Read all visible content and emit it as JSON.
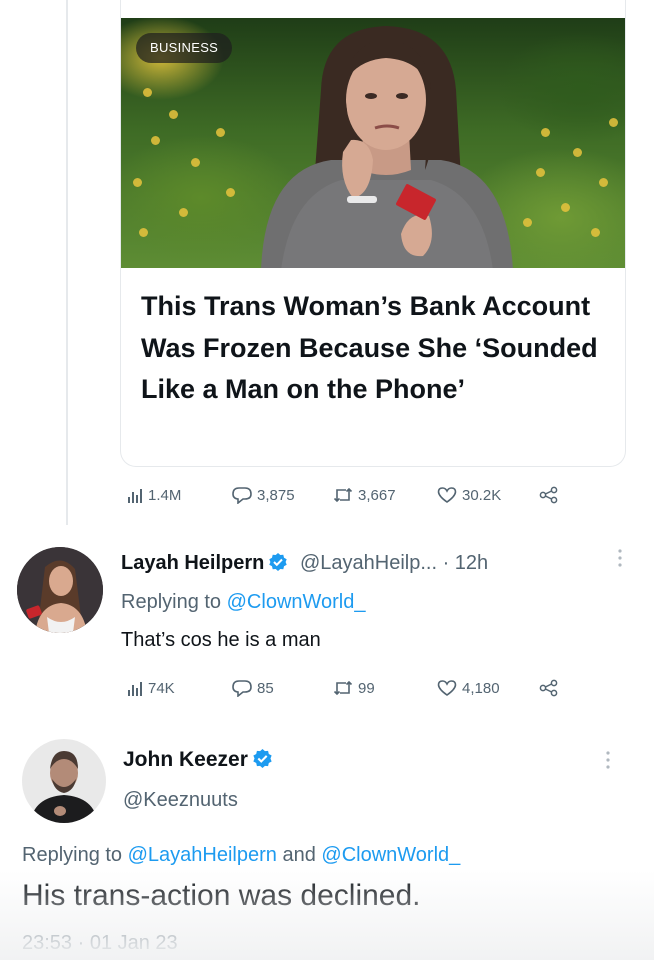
{
  "article": {
    "category_badge": "BUSINESS",
    "headline": "This Trans Woman’s Bank Account Was Frozen Because She ‘Sounded Like a Man on the Phone’"
  },
  "article_stats": {
    "views": "1.4M",
    "replies": "3,875",
    "retweets": "3,667",
    "likes": "30.2K"
  },
  "reply1": {
    "name": "Layah Heilpern",
    "handle": "@LayahHeilp...",
    "separator": "·",
    "time": "12h",
    "replying_prefix": "Replying to",
    "replying_to": "@ClownWorld_",
    "text": "That’s cos he is a man",
    "views": "74K",
    "replies": "85",
    "retweets": "99",
    "likes": "4,180"
  },
  "reply2": {
    "name": "John Keezer",
    "handle": "@Keeznuuts",
    "replying_prefix": "Replying to",
    "replying_to_1": "@LayahHeilpern",
    "replying_and": "and",
    "replying_to_2": "@ClownWorld_",
    "text": "His trans-action was declined.",
    "timestamp": "23:53 · 01 Jan 23"
  },
  "colors": {
    "link_blue": "#1d9bf0",
    "muted_gray": "#536471",
    "text_dark": "#0f1419",
    "verified_blue": "#1d9bf0"
  },
  "icons": [
    "views-icon",
    "reply-icon",
    "retweet-icon",
    "like-icon",
    "share-icon",
    "verified-badge-icon",
    "more-options-icon"
  ]
}
